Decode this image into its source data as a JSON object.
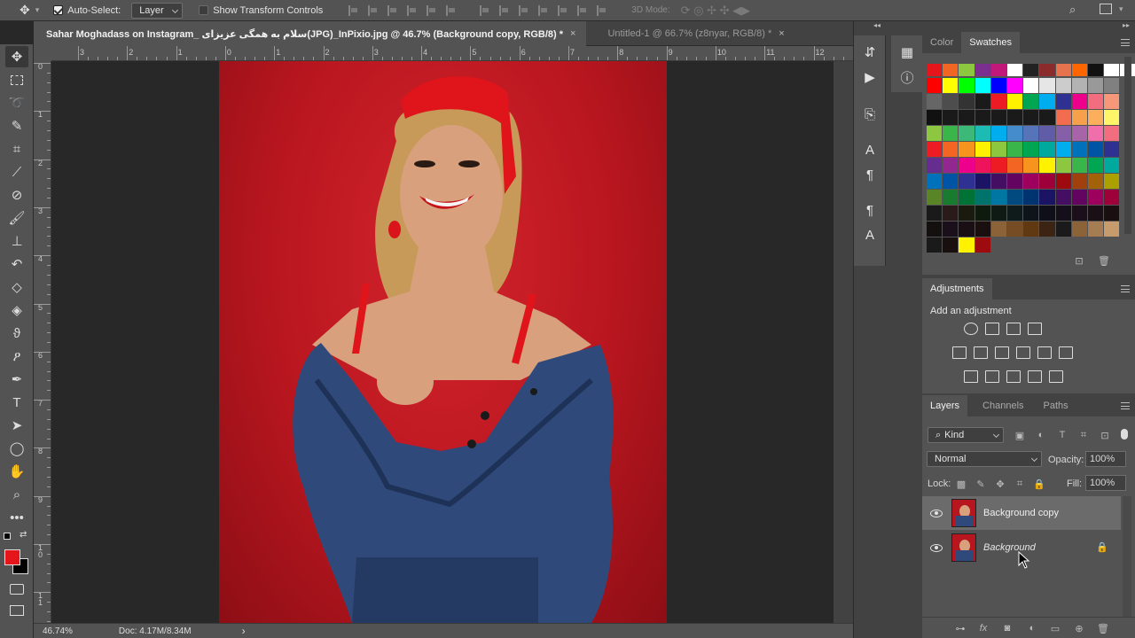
{
  "options_bar": {
    "auto_select_label": "Auto-Select:",
    "auto_select_value": "Layer",
    "show_transform_label": "Show Transform Controls",
    "mode_3d_label": "3D Mode:"
  },
  "tabs": [
    {
      "label": "Sahar Moghadass on Instagram_ سلام به همگی عزیزای(JPG)_InPixio.jpg @ 46.7% (Background copy, RGB/8) *",
      "close": "×"
    },
    {
      "label": "Untitled-1 @ 66.7% (z8nyar, RGB/8) *",
      "close": "×"
    }
  ],
  "rulers": {
    "top": [
      "3",
      "2",
      "1",
      "0",
      "1",
      "2",
      "3",
      "4",
      "5",
      "6",
      "7",
      "8",
      "9",
      "10",
      "11",
      "12"
    ],
    "left": [
      "0",
      "1",
      "2",
      "3",
      "4",
      "5",
      "6",
      "7",
      "8",
      "9",
      "1\n0",
      "1\n1"
    ]
  },
  "status": {
    "zoom": "46.74%",
    "doc": "Doc: 4.17M/8.34M",
    "arrow": "›"
  },
  "color_panel": {
    "tabs": [
      "Color",
      "Swatches"
    ],
    "active_tab": "Swatches"
  },
  "adjustments": {
    "title": "Adjustments",
    "subtitle": "Add an adjustment"
  },
  "layers_panel": {
    "tabs": [
      "Layers",
      "Channels",
      "Paths"
    ],
    "filter_label": "Kind",
    "blend_mode": "Normal",
    "opacity_label": "Opacity:",
    "opacity_value": "100%",
    "lock_label": "Lock:",
    "fill_label": "Fill:",
    "fill_value": "100%",
    "layers": [
      {
        "name": "Background copy",
        "selected": true,
        "locked": false
      },
      {
        "name": "Background",
        "selected": false,
        "locked": true
      }
    ],
    "footer_fx": "fx"
  },
  "colors": {
    "foreground": "#e4161c",
    "background": "#000000",
    "accent": "#b8161f"
  },
  "icons": {
    "tools": [
      "move-icon",
      "marquee-icon",
      "lasso-icon",
      "quick-select-icon",
      "crop-icon",
      "eyedropper-icon",
      "healing-icon",
      "brush-icon",
      "stamp-icon",
      "history-brush-icon",
      "eraser-icon",
      "paint-bucket-icon",
      "smudge-icon",
      "dodge-icon",
      "pen-icon",
      "type-icon",
      "path-select-icon",
      "ellipse-icon",
      "hand-icon",
      "zoom-icon",
      "more-tools-icon"
    ]
  }
}
